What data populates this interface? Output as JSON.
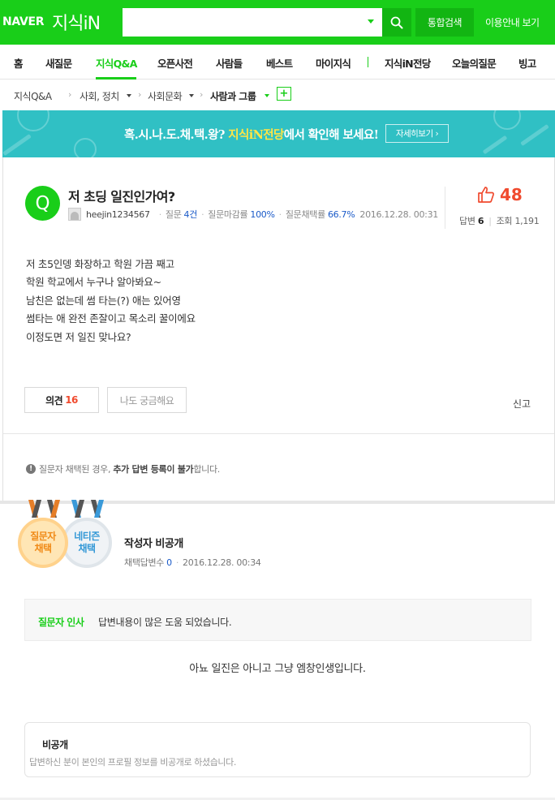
{
  "header": {
    "naver_logo": "NAVER",
    "service_logo": "지식iN",
    "search": {
      "value": "",
      "placeholder": ""
    },
    "total_search_label": "통합검색",
    "guide_label": "이용안내 보기"
  },
  "nav": {
    "items": [
      {
        "label": "홈"
      },
      {
        "label": "새질문"
      },
      {
        "label": "지식Q&A"
      },
      {
        "label": "오픈사전"
      },
      {
        "label": "사람들"
      },
      {
        "label": "베스트"
      },
      {
        "label": "마이지식"
      },
      {
        "label": "지식iN전당"
      },
      {
        "label": "오늘의질문"
      },
      {
        "label": "빙고"
      }
    ],
    "active": "지식Q&A"
  },
  "breadcrumb": {
    "items": [
      {
        "label": "지식Q&A"
      },
      {
        "label": "사회, 정치"
      },
      {
        "label": "사회문화"
      },
      {
        "label": "사람과 그룹"
      }
    ],
    "add_label": "+"
  },
  "banner": {
    "text_pre": "혹.시.나.도.채.택.왕?",
    "text_highlight": "지식iN전당",
    "text_post": "에서 확인해 보세요!",
    "button_label": "자세히보기 ›"
  },
  "question": {
    "badge": "Q",
    "title": "저 초딩 일진인가여?",
    "author": "heejin1234567",
    "question_label": "질문",
    "question_count": "4건",
    "deadline_label": "질문마감률",
    "deadline_rate": "100%",
    "adopt_label": "질문채택률",
    "adopt_rate": "66.7%",
    "date": "2016.12.28. 00:31",
    "likes": "48",
    "answer_label": "답변",
    "answer_count": "6",
    "view_label": "조회",
    "view_count": "1,191",
    "body": [
      "저 초5인뎅 화장하고 학원 가끔 째고",
      "학원 학교에서 누구나 알아봐요~",
      "남친은 없는데 썸 타는(?) 애는 있어영",
      "썸타는 애 완전 존잘이고 목소리 꿀이에요",
      "이정도면 저 일진 맞나요?"
    ],
    "opinion_label": "의견",
    "opinion_count": "16",
    "curious_label": "나도 궁금해요",
    "report_label": "신고",
    "notice_pre": "질문자 채택된 경우,",
    "notice_bold": "추가 답변 등록이 불가",
    "notice_post": "합니다."
  },
  "answer": {
    "medal_questioner": [
      "질문자",
      "채택"
    ],
    "medal_netizen": [
      "네티즌",
      "채택"
    ],
    "author": "작성자 비공개",
    "adopt_count_label": "채택답변수",
    "adopt_count": "0",
    "date": "2016.12.28. 00:34",
    "greeting_label": "질문자 인사",
    "greeting_text": "답변내용이 많은 도움 되었습니다.",
    "body": "아뇨 일진은 아니고 그냥 엠창인생입니다.",
    "private_title": "비공개",
    "private_desc": "답변하신 분이 본인의 프로필 정보를 비공개로 하셨습니다."
  },
  "colors": {
    "brand_green": "#19ce19",
    "banner_teal": "#30c0c4",
    "like_red": "#f04a2e",
    "link_blue": "#1a5ac8"
  },
  "icons": [
    "search-icon",
    "dropdown-caret-icon",
    "like-icon",
    "warning-icon",
    "avatar-icon",
    "medal-icon"
  ]
}
